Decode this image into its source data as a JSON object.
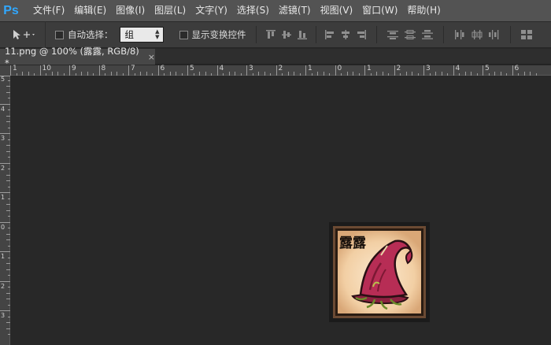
{
  "app": {
    "logo": "Ps"
  },
  "menu": [
    "文件(F)",
    "编辑(E)",
    "图像(I)",
    "图层(L)",
    "文字(Y)",
    "选择(S)",
    "滤镜(T)",
    "视图(V)",
    "窗口(W)",
    "帮助(H)"
  ],
  "options": {
    "auto_select_label": "自动选择：",
    "auto_select_value": "组",
    "show_transform_label": "显示变换控件"
  },
  "document": {
    "tab_title": "11.png @ 100% (露露, RGB/8) *",
    "close_glyph": "×"
  },
  "ruler": {
    "h_labels": [
      "1",
      "10",
      "9",
      "8",
      "7",
      "6",
      "5",
      "4",
      "3",
      "2",
      "1",
      "0",
      "1",
      "2",
      "3",
      "4",
      "5",
      "6"
    ],
    "v_labels": [
      "5",
      "4",
      "3",
      "2",
      "1",
      "0",
      "1",
      "2",
      "3"
    ]
  },
  "image": {
    "caption": "露露"
  }
}
